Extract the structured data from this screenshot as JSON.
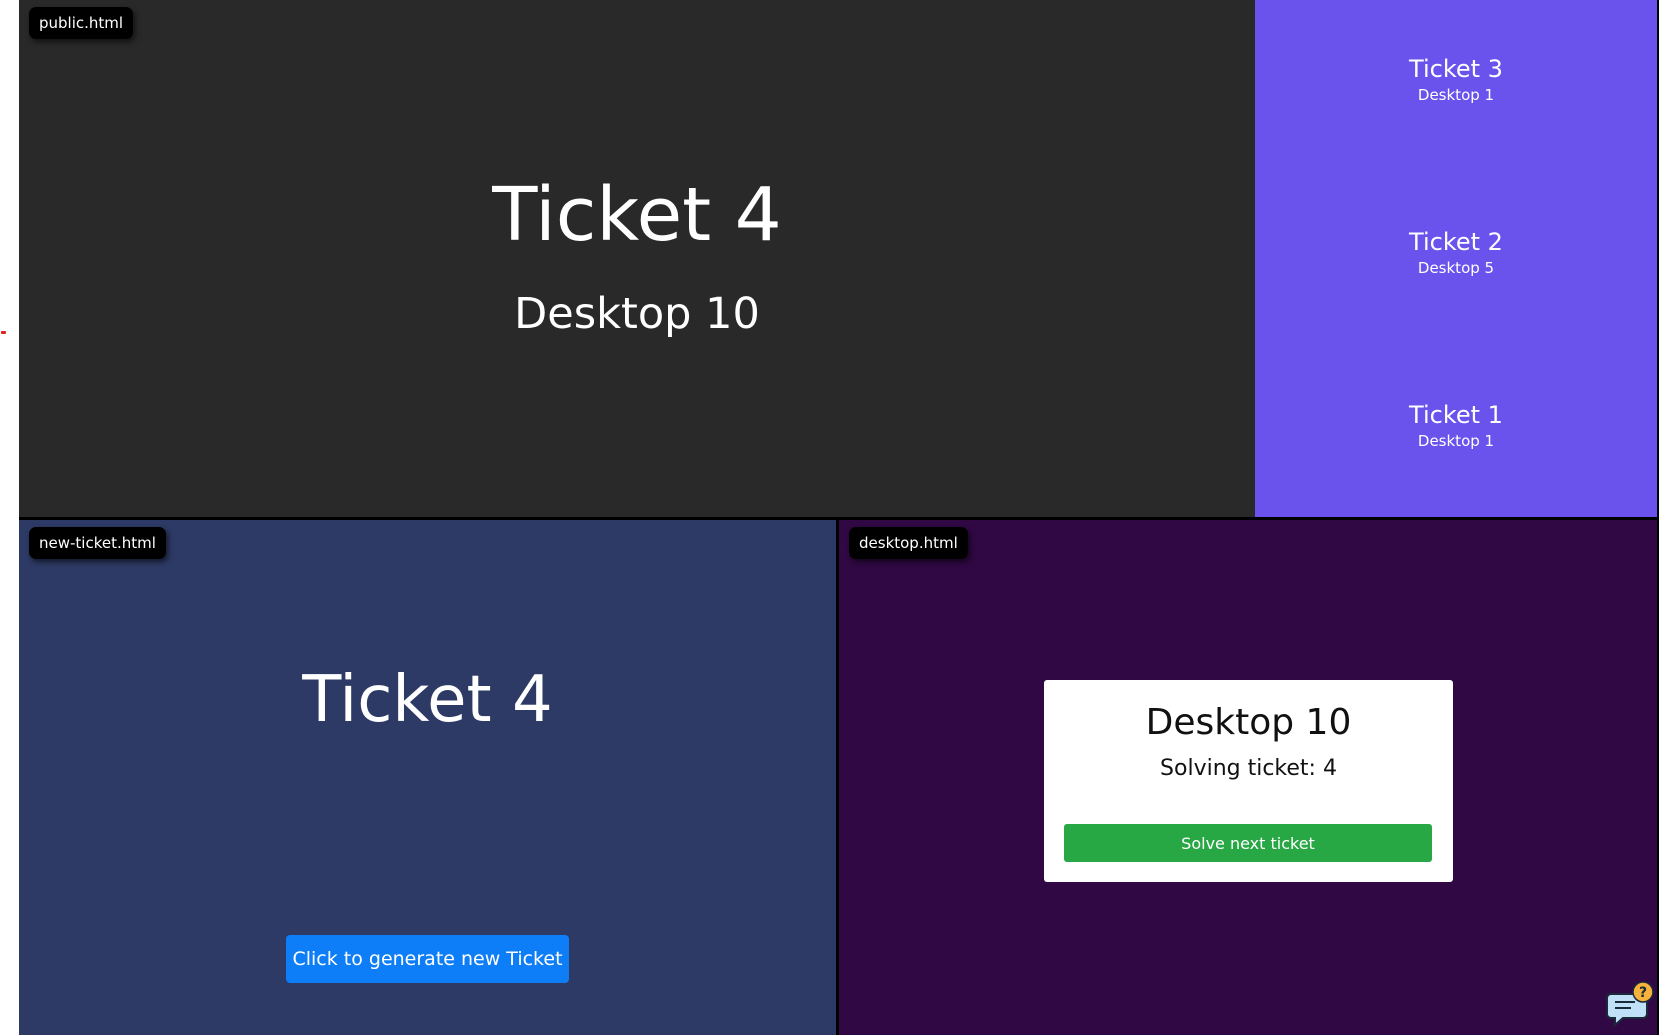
{
  "public": {
    "file_label": "public.html",
    "current_ticket": "Ticket 4",
    "current_desktop": "Desktop 10",
    "recent": [
      {
        "ticket": "Ticket 3",
        "desktop": "Desktop 1"
      },
      {
        "ticket": "Ticket 2",
        "desktop": "Desktop 5"
      },
      {
        "ticket": "Ticket 1",
        "desktop": "Desktop 1"
      }
    ]
  },
  "new_ticket": {
    "file_label": "new-ticket.html",
    "ticket_label": "Ticket 4",
    "button_label": "Click to generate new Ticket"
  },
  "desktop": {
    "file_label": "desktop.html",
    "title": "Desktop 10",
    "solving": "Solving ticket: 4",
    "button_label": "Solve next ticket"
  },
  "help_widget": {
    "icon": "chat-help-icon",
    "symbol": "?"
  },
  "colors": {
    "public_bg": "#292929",
    "public_side_bg": "#6a52ed",
    "new_ticket_bg": "#2d3a65",
    "desktop_bg": "#300844",
    "primary_button": "#0d7ef8",
    "success_button": "#28a745",
    "help_accent": "#f7b23b"
  }
}
